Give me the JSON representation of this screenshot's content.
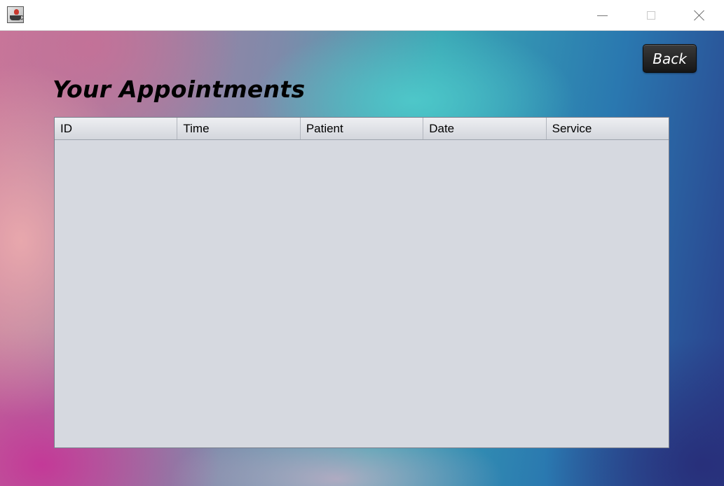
{
  "window": {
    "icon": "java-coffee-cup-icon",
    "controls": [
      "minimize-icon",
      "maximize-icon",
      "close-icon"
    ]
  },
  "page": {
    "back_label": "Back",
    "title": "Your Appointments"
  },
  "table": {
    "columns": [
      {
        "key": "id",
        "label": "ID"
      },
      {
        "key": "time",
        "label": "Time"
      },
      {
        "key": "patient",
        "label": "Patient"
      },
      {
        "key": "date",
        "label": "Date"
      },
      {
        "key": "service",
        "label": "Service"
      }
    ],
    "rows": []
  },
  "colors": {
    "header_bg": "#dfe1e6",
    "body_bg": "#d6d9e0",
    "button_bg": "#222222"
  }
}
